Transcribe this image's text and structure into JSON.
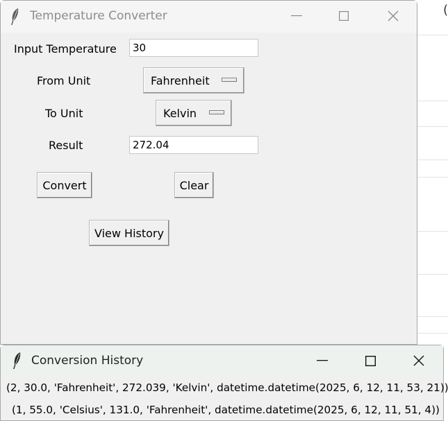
{
  "main_window": {
    "title": "Temperature Converter",
    "form": {
      "input_label": "Input Temperature",
      "input_value": "30",
      "from_label": "From Unit",
      "from_selected": "Fahrenheit",
      "to_label": "To Unit",
      "to_selected": "Kelvin",
      "result_label": "Result",
      "result_value": "272.04"
    },
    "buttons": {
      "convert": "Convert",
      "clear": "Clear",
      "view_history": "View History"
    }
  },
  "history_window": {
    "title": "Conversion History",
    "entries": [
      "(2, 30.0, 'Fahrenheit', 272.039, 'Kelvin', datetime.datetime(2025, 6, 12, 11, 53, 21))",
      "(1, 55.0, 'Celsius', 131.0, 'Fahrenheit', datetime.datetime(2025, 6, 12, 11, 51, 4))"
    ]
  },
  "background_app": {
    "partial_glyph": "("
  },
  "icons": {
    "app": "feather-icon",
    "minimize": "minimize-icon",
    "maximize": "maximize-icon",
    "close": "close-icon"
  }
}
